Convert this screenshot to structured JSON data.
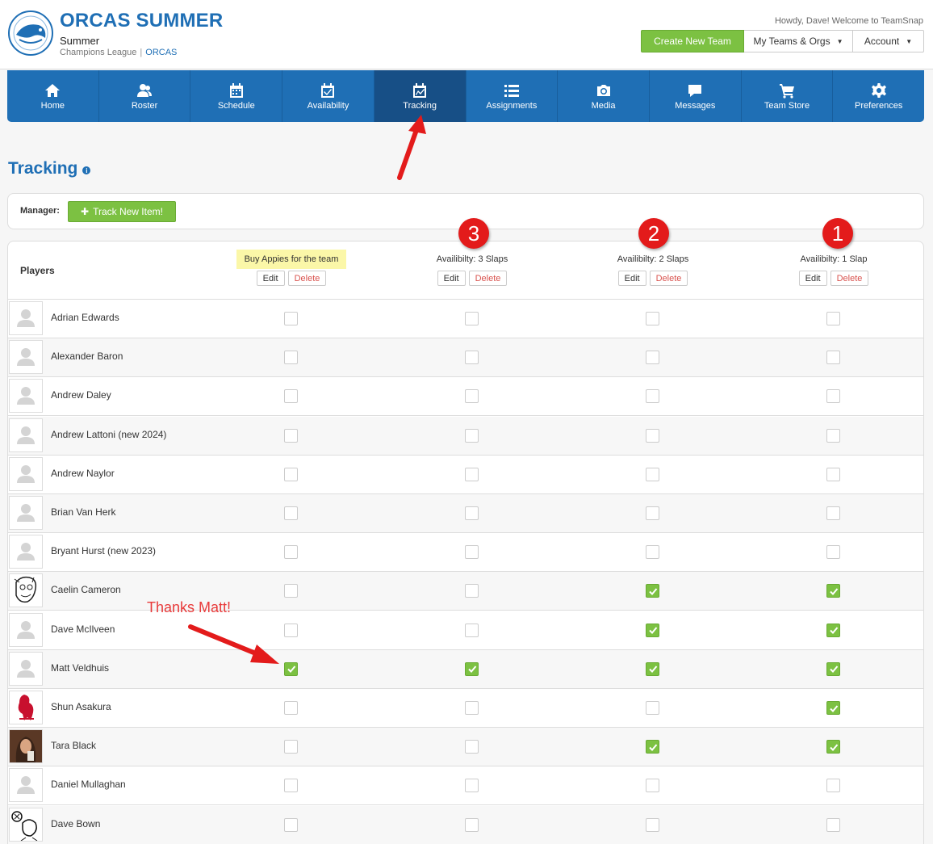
{
  "header": {
    "team_name": "ORCAS SUMMER",
    "season": "Summer",
    "league": "Champions League",
    "org": "ORCAS",
    "greeting": "Howdy, Dave! Welcome to TeamSnap",
    "create_team_label": "Create New Team",
    "my_teams_label": "My Teams & Orgs",
    "account_label": "Account"
  },
  "nav": {
    "items": [
      {
        "label": "Home",
        "icon": "home-icon"
      },
      {
        "label": "Roster",
        "icon": "roster-icon"
      },
      {
        "label": "Schedule",
        "icon": "calendar-icon"
      },
      {
        "label": "Availability",
        "icon": "availability-icon"
      },
      {
        "label": "Tracking",
        "icon": "tracking-icon",
        "active": true
      },
      {
        "label": "Assignments",
        "icon": "list-icon"
      },
      {
        "label": "Media",
        "icon": "camera-icon"
      },
      {
        "label": "Messages",
        "icon": "chat-icon"
      },
      {
        "label": "Team Store",
        "icon": "cart-icon"
      },
      {
        "label": "Preferences",
        "icon": "gear-icon"
      }
    ]
  },
  "page": {
    "title": "Tracking",
    "manager_label": "Manager:",
    "track_button": "Track New Item!",
    "players_label": "Players"
  },
  "annotations": {
    "thanks": "Thanks Matt!",
    "badges": [
      "3",
      "2",
      "1"
    ],
    "accent": "#e31b1b"
  },
  "columns": [
    {
      "title": "Buy Appies for the team",
      "highlight": true
    },
    {
      "title": "Availibilty: 3 Slaps"
    },
    {
      "title": "Availibilty: 2 Slaps"
    },
    {
      "title": "Availibilty: 1 Slap"
    }
  ],
  "column_actions": {
    "edit": "Edit",
    "delete": "Delete"
  },
  "players": [
    {
      "name": "Adrian Edwards",
      "checks": [
        false,
        false,
        false,
        false
      ]
    },
    {
      "name": "Alexander Baron",
      "checks": [
        false,
        false,
        false,
        false
      ]
    },
    {
      "name": "Andrew Daley",
      "checks": [
        false,
        false,
        false,
        false
      ]
    },
    {
      "name": "Andrew Lattoni (new 2024)",
      "checks": [
        false,
        false,
        false,
        false
      ]
    },
    {
      "name": "Andrew Naylor",
      "checks": [
        false,
        false,
        false,
        false
      ]
    },
    {
      "name": "Brian Van Herk",
      "checks": [
        false,
        false,
        false,
        false
      ]
    },
    {
      "name": "Bryant Hurst (new 2023)",
      "checks": [
        false,
        false,
        false,
        false
      ]
    },
    {
      "name": "Caelin Cameron",
      "checks": [
        false,
        false,
        true,
        true
      ],
      "avatar": "cartoon"
    },
    {
      "name": "Dave McIlveen",
      "checks": [
        false,
        false,
        true,
        true
      ]
    },
    {
      "name": "Matt Veldhuis",
      "checks": [
        true,
        true,
        true,
        true
      ]
    },
    {
      "name": "Shun Asakura",
      "checks": [
        false,
        false,
        false,
        true
      ],
      "avatar": "bird"
    },
    {
      "name": "Tara Black",
      "checks": [
        false,
        false,
        true,
        true
      ],
      "avatar": "photo"
    },
    {
      "name": "Daniel Mullaghan",
      "checks": [
        false,
        false,
        false,
        false
      ]
    },
    {
      "name": "Dave Bown",
      "checks": [
        false,
        false,
        false,
        false
      ],
      "avatar": "sketch"
    }
  ],
  "colors": {
    "brand": "#1f6fb5",
    "green": "#7cc142",
    "highlight": "#fbf7a8"
  }
}
